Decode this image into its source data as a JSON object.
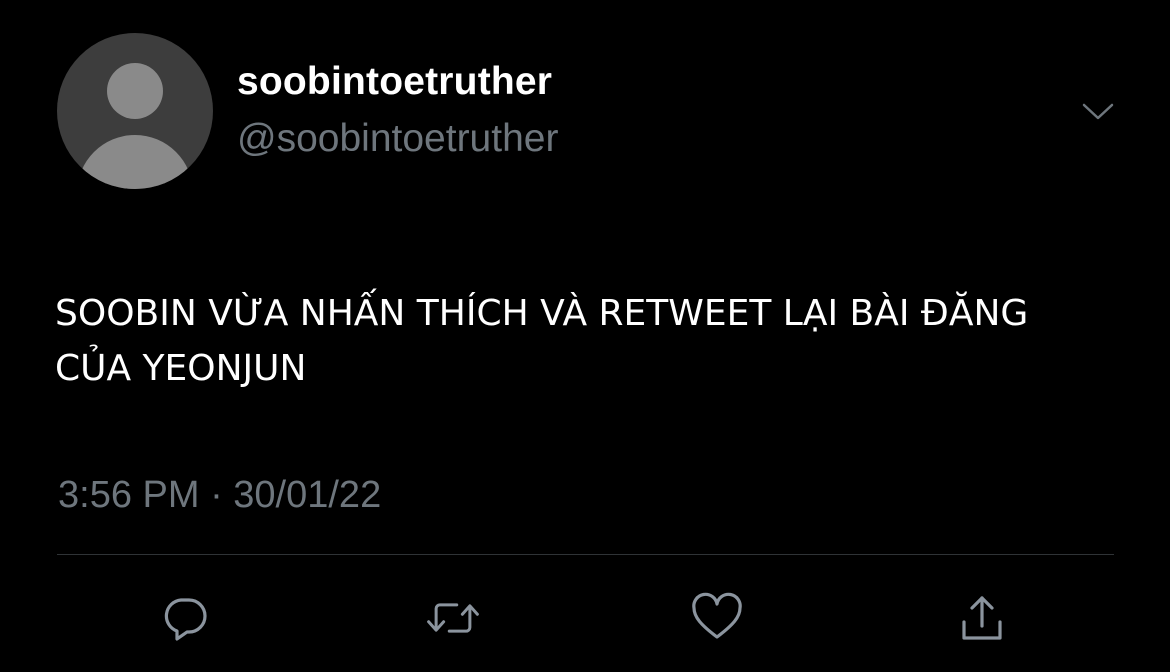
{
  "tweet": {
    "display_name": "soobintoetruther",
    "handle": "@soobintoetruther",
    "text_line1": "SOOBIN VỪA NHẤN THÍCH VÀ RETWEET LẠI BÀI ĐĂNG",
    "text_line2": "CỦA YEONJUN",
    "timestamp": "3:56 PM · 30/01/22"
  },
  "icons": {
    "avatar": "default-avatar-silhouette",
    "more": "chevron-down-icon",
    "reply": "reply-icon",
    "retweet": "retweet-icon",
    "like": "heart-icon",
    "share": "share-icon"
  },
  "colors": {
    "background": "#000000",
    "primary_text": "#ffffff",
    "secondary_text": "#6e767d",
    "divider": "#2f3336",
    "avatar_bg": "#3d3d3d",
    "avatar_figure": "#8a8a8a"
  }
}
